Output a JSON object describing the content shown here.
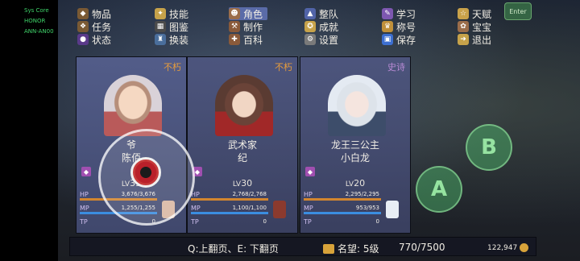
{
  "system": {
    "lines": [
      "Sys Core",
      "HONOR",
      "ANN-AN00"
    ]
  },
  "menu": {
    "items": [
      {
        "label": "物品",
        "icon": "bag-icon"
      },
      {
        "label": "技能",
        "icon": "skill-icon"
      },
      {
        "label": "角色",
        "icon": "character-icon",
        "active": true
      },
      {
        "label": "整队",
        "icon": "team-icon"
      },
      {
        "label": "学习",
        "icon": "study-icon"
      },
      {
        "label": "天赋",
        "icon": "talent-icon"
      },
      {
        "label": "任务",
        "icon": "quest-icon"
      },
      {
        "label": "图鉴",
        "icon": "codex-icon"
      },
      {
        "label": "制作",
        "icon": "craft-icon"
      },
      {
        "label": "成就",
        "icon": "achievement-icon"
      },
      {
        "label": "称号",
        "icon": "title-icon"
      },
      {
        "label": "宝宝",
        "icon": "pet-icon"
      },
      {
        "label": "状态",
        "icon": "status-icon"
      },
      {
        "label": "换装",
        "icon": "outfit-icon"
      },
      {
        "label": "百科",
        "icon": "encyclopedia-icon"
      },
      {
        "label": "设置",
        "icon": "settings-icon"
      },
      {
        "label": "保存",
        "icon": "save-icon"
      },
      {
        "label": "退出",
        "icon": "exit-icon"
      }
    ],
    "corner_button": "Enter"
  },
  "characters": [
    {
      "rank": "不朽",
      "title": "爷",
      "name": "陈佰",
      "element": "◆",
      "level_prefix": "LV",
      "level": "35",
      "hp_label": "HP",
      "hp": "3,676/3,676",
      "hp_fill": 1.0,
      "mp_label": "MP",
      "mp": "1,255/1,255",
      "mp_fill": 1.0,
      "tp_label": "TP",
      "tp": "0"
    },
    {
      "rank": "不朽",
      "title": "武术家",
      "name": "纪",
      "element": "◆",
      "level_prefix": "LV",
      "level": "30",
      "hp_label": "HP",
      "hp": "2,768/2,768",
      "hp_fill": 1.0,
      "mp_label": "MP",
      "mp": "1,100/1,100",
      "mp_fill": 1.0,
      "tp_label": "TP",
      "tp": "0"
    },
    {
      "rank": "史诗",
      "title": "龙王三公主",
      "name": "小白龙",
      "element": "◆",
      "level_prefix": "LV",
      "level": "20",
      "hp_label": "HP",
      "hp": "2,295/2,295",
      "hp_fill": 1.0,
      "mp_label": "MP",
      "mp": "953/953",
      "mp_fill": 1.0,
      "tp_label": "TP",
      "tp": "0"
    }
  ],
  "footer": {
    "page_hint": "Q:上翻页、E: 下翻页",
    "fame_label": "名望: 5级",
    "fame_progress": "770/7500",
    "gold": "122,947"
  },
  "controls": {
    "a_label": "A",
    "b_label": "B"
  },
  "colors": {
    "immortal": "#e79c3c",
    "epic": "#b98bd6",
    "menu_active": "#5a6ba8",
    "hp": "#d2862f",
    "mp": "#3b8de0"
  }
}
